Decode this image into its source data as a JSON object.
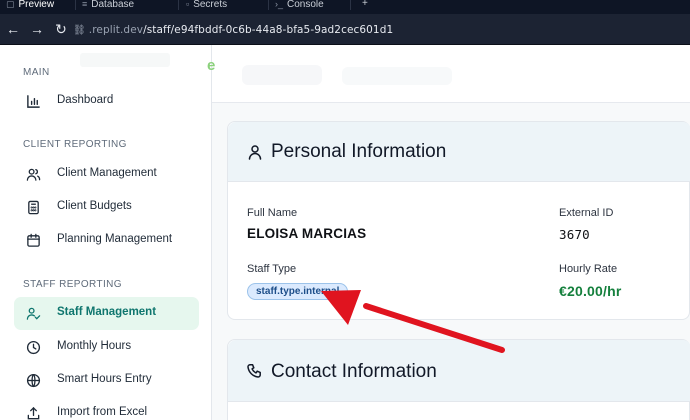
{
  "browser": {
    "tabs": [
      {
        "label": "Preview",
        "icon": "preview-icon"
      },
      {
        "label": "Database",
        "icon": "database-icon"
      },
      {
        "label": "Secrets",
        "icon": "lock-icon"
      },
      {
        "label": "Console",
        "icon": "console-icon"
      },
      {
        "label": "+",
        "icon": "plus-icon"
      }
    ],
    "url_domain": ".replit.dev",
    "url_path": "/staff/e94fbddf-0c6b-44a8-bfa5-9ad2cec601d1"
  },
  "sidebar": {
    "sections": [
      {
        "title": "MAIN",
        "items": [
          {
            "label": "Dashboard",
            "icon": "bar-chart-icon"
          }
        ]
      },
      {
        "title": "CLIENT REPORTING",
        "items": [
          {
            "label": "Client Management",
            "icon": "users-icon"
          },
          {
            "label": "Client Budgets",
            "icon": "calculator-icon"
          },
          {
            "label": "Planning Management",
            "icon": "calendar-icon"
          }
        ]
      },
      {
        "title": "STAFF REPORTING",
        "items": [
          {
            "label": "Staff Management",
            "icon": "user-check-icon",
            "active": true
          },
          {
            "label": "Monthly Hours",
            "icon": "clock-icon"
          },
          {
            "label": "Smart Hours Entry",
            "icon": "globe-icon"
          },
          {
            "label": "Import from Excel",
            "icon": "upload-icon"
          }
        ]
      }
    ]
  },
  "main": {
    "personal": {
      "title": "Personal Information",
      "full_name_label": "Full Name",
      "full_name": "ELOISA MARCIAS",
      "external_id_label": "External ID",
      "external_id": "3670",
      "staff_type_label": "Staff Type",
      "staff_type": "staff.type.internal",
      "hourly_rate_label": "Hourly Rate",
      "hourly_rate": "€20.00/hr"
    },
    "contact": {
      "title": "Contact Information"
    }
  },
  "colors": {
    "accent_green": "#15803d",
    "active_bg": "#e6f7ee",
    "badge_bg": "#dbeafe",
    "annotation_arrow": "#e0141f"
  }
}
